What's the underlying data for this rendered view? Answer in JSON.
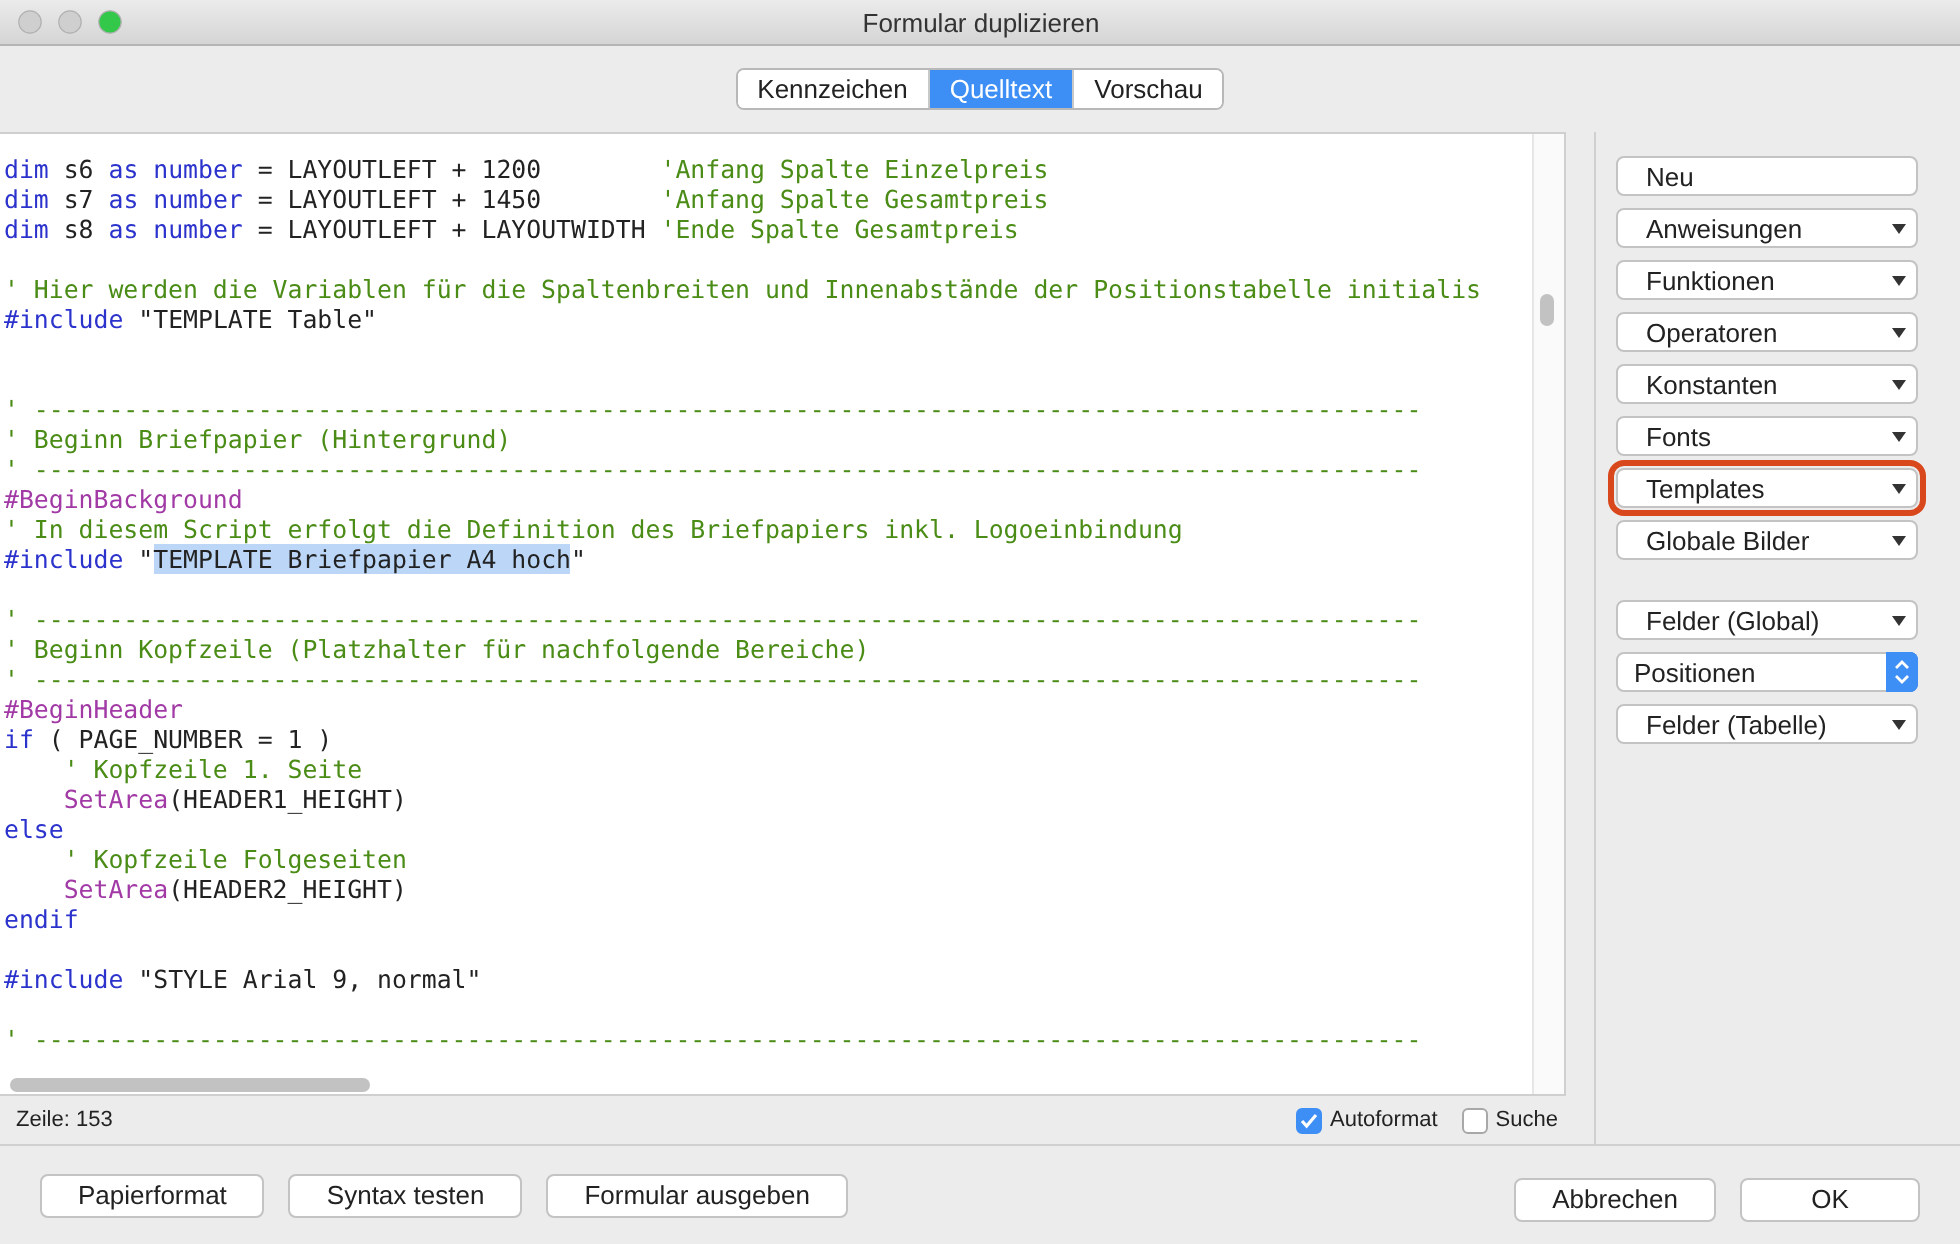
{
  "window": {
    "title": "Formular duplizieren"
  },
  "tabs": [
    {
      "label": "Kennzeichen",
      "selected": false
    },
    {
      "label": "Quelltext",
      "selected": true
    },
    {
      "label": "Vorschau",
      "selected": false
    }
  ],
  "editor": {
    "lines": [
      {
        "kind": "code",
        "tokens": [
          {
            "kind": "keyword",
            "text": "dim"
          },
          {
            "kind": "plain",
            "text": " s6 "
          },
          {
            "kind": "keyword",
            "text": "as"
          },
          {
            "kind": "keyword",
            "text": " number"
          },
          {
            "kind": "plain",
            "text": " = LAYOUTLEFT + 1200        "
          },
          {
            "kind": "comment",
            "text": "'Anfang Spalte Einzelpreis"
          }
        ]
      },
      {
        "kind": "code",
        "tokens": [
          {
            "kind": "keyword",
            "text": "dim"
          },
          {
            "kind": "plain",
            "text": " s7 "
          },
          {
            "kind": "keyword",
            "text": "as"
          },
          {
            "kind": "keyword",
            "text": " number"
          },
          {
            "kind": "plain",
            "text": " = LAYOUTLEFT + 1450        "
          },
          {
            "kind": "comment",
            "text": "'Anfang Spalte Gesamtpreis"
          }
        ]
      },
      {
        "kind": "code",
        "tokens": [
          {
            "kind": "keyword",
            "text": "dim"
          },
          {
            "kind": "plain",
            "text": " s8 "
          },
          {
            "kind": "keyword",
            "text": "as"
          },
          {
            "kind": "keyword",
            "text": " number"
          },
          {
            "kind": "plain",
            "text": " = LAYOUTLEFT + LAYOUTWIDTH "
          },
          {
            "kind": "comment",
            "text": "'Ende Spalte Gesamtpreis"
          }
        ]
      },
      {
        "kind": "blank"
      },
      {
        "kind": "code",
        "tokens": [
          {
            "kind": "comment",
            "text": "' Hier werden die Variablen für die Spaltenbreiten und Innenabstände der Positionstabelle initialis"
          }
        ]
      },
      {
        "kind": "code",
        "tokens": [
          {
            "kind": "keyword",
            "text": "#include"
          },
          {
            "kind": "plain",
            "text": " \"TEMPLATE Table\""
          }
        ]
      },
      {
        "kind": "blank"
      },
      {
        "kind": "blank"
      },
      {
        "kind": "code",
        "tokens": [
          {
            "kind": "comment",
            "text": "' ---------------------------------------------------------------------------------------------"
          }
        ]
      },
      {
        "kind": "code",
        "tokens": [
          {
            "kind": "comment",
            "text": "' Beginn Briefpapier (Hintergrund)"
          }
        ]
      },
      {
        "kind": "code",
        "tokens": [
          {
            "kind": "comment",
            "text": "' ---------------------------------------------------------------------------------------------"
          }
        ]
      },
      {
        "kind": "code",
        "tokens": [
          {
            "kind": "directive",
            "text": "#BeginBackground"
          }
        ]
      },
      {
        "kind": "code",
        "tokens": [
          {
            "kind": "comment",
            "text": "' In diesem Script erfolgt die Definition des Briefpapiers inkl. Logoeinbindung"
          }
        ]
      },
      {
        "kind": "code",
        "tokens": [
          {
            "kind": "keyword",
            "text": "#include"
          },
          {
            "kind": "plain",
            "text": " \""
          },
          {
            "kind": "selection",
            "text": "TEMPLATE Briefpapier A4 hoch"
          },
          {
            "kind": "plain",
            "text": "\""
          }
        ]
      },
      {
        "kind": "blank"
      },
      {
        "kind": "code",
        "tokens": [
          {
            "kind": "comment",
            "text": "' ---------------------------------------------------------------------------------------------"
          }
        ]
      },
      {
        "kind": "code",
        "tokens": [
          {
            "kind": "comment",
            "text": "' Beginn Kopfzeile (Platzhalter für nachfolgende Bereiche)"
          }
        ]
      },
      {
        "kind": "code",
        "tokens": [
          {
            "kind": "comment",
            "text": "' ---------------------------------------------------------------------------------------------"
          }
        ]
      },
      {
        "kind": "code",
        "tokens": [
          {
            "kind": "directive",
            "text": "#BeginHeader"
          }
        ]
      },
      {
        "kind": "code",
        "tokens": [
          {
            "kind": "keyword",
            "text": "if"
          },
          {
            "kind": "plain",
            "text": " ( PAGE_NUMBER = 1 )"
          }
        ]
      },
      {
        "kind": "code",
        "tokens": [
          {
            "kind": "comment",
            "text": "    ' Kopfzeile 1. Seite"
          }
        ]
      },
      {
        "kind": "code",
        "tokens": [
          {
            "kind": "directive",
            "text": "    SetArea"
          },
          {
            "kind": "plain",
            "text": "(HEADER1_HEIGHT)"
          }
        ]
      },
      {
        "kind": "code",
        "tokens": [
          {
            "kind": "keyword",
            "text": "else"
          }
        ]
      },
      {
        "kind": "code",
        "tokens": [
          {
            "kind": "comment",
            "text": "    ' Kopfzeile Folgeseiten"
          }
        ]
      },
      {
        "kind": "code",
        "tokens": [
          {
            "kind": "directive",
            "text": "    SetArea"
          },
          {
            "kind": "plain",
            "text": "(HEADER2_HEIGHT)"
          }
        ]
      },
      {
        "kind": "code",
        "tokens": [
          {
            "kind": "keyword",
            "text": "endif"
          }
        ]
      },
      {
        "kind": "blank"
      },
      {
        "kind": "code",
        "tokens": [
          {
            "kind": "keyword",
            "text": "#include"
          },
          {
            "kind": "plain",
            "text": " \"STYLE Arial 9, normal\""
          }
        ]
      },
      {
        "kind": "blank"
      },
      {
        "kind": "code",
        "tokens": [
          {
            "kind": "comment",
            "text": "' ---------------------------------------------------------------------------------------------"
          }
        ]
      }
    ],
    "status": "Zeile: 153",
    "checkboxes": [
      {
        "label": "Autoformat",
        "checked": true
      },
      {
        "label": "Suche",
        "checked": false
      }
    ]
  },
  "side_groups": [
    [
      {
        "label": "Neu",
        "kind": "push",
        "highlighted": false
      },
      {
        "label": "Anweisungen",
        "kind": "pulldown",
        "highlighted": false
      },
      {
        "label": "Funktionen",
        "kind": "pulldown",
        "highlighted": false
      },
      {
        "label": "Operatoren",
        "kind": "pulldown",
        "highlighted": false
      },
      {
        "label": "Konstanten",
        "kind": "pulldown",
        "highlighted": false
      },
      {
        "label": "Fonts",
        "kind": "pulldown",
        "highlighted": false
      },
      {
        "label": "Templates",
        "kind": "pulldown",
        "highlighted": true
      },
      {
        "label": "Globale Bilder",
        "kind": "pulldown",
        "highlighted": false
      }
    ],
    [
      {
        "label": "Felder (Global)",
        "kind": "pulldown",
        "highlighted": false
      },
      {
        "label": "Positionen",
        "kind": "popup",
        "highlighted": false
      },
      {
        "label": "Felder (Tabelle)",
        "kind": "pulldown",
        "highlighted": false
      }
    ]
  ],
  "footer_buttons": [
    "Papierformat",
    "Syntax testen",
    "Formular ausgeben"
  ],
  "dialog_buttons": [
    "Abbrechen",
    "OK"
  ]
}
